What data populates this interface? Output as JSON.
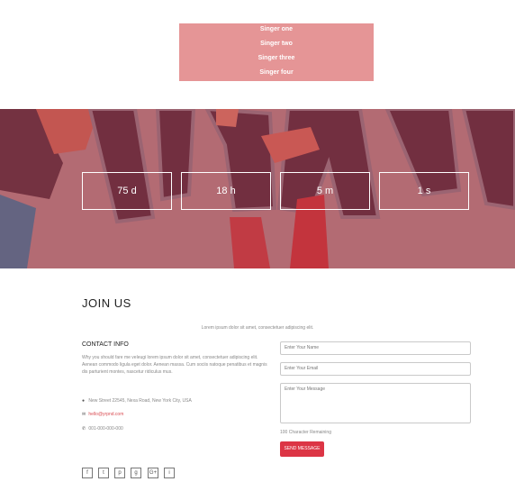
{
  "menu": {
    "items": [
      {
        "label": "Singer one"
      },
      {
        "label": "Singer two"
      },
      {
        "label": "Singer three"
      },
      {
        "label": "Singer four"
      }
    ]
  },
  "countdown": {
    "days": "75 d",
    "hours": "18 h",
    "minutes": "5 m",
    "seconds": "1 s"
  },
  "join": {
    "title": "JOIN US",
    "subtitle": "Lorem ipsum dolor sit amet, consectetuer adipiscing elit."
  },
  "contact": {
    "title": "CONTACT INFO",
    "description": "Why you should fare me veleugi lorem ipsum dolor sit amet, consectetuer adipiscing elit. Aenean commodo ligula eget dolor. Aenean massa. Cum sociis natoque penatibus et magnis dis parturient montes, nascetur ridiculus mus.",
    "address": "New Street 22545, Nexa Road, New York City, USA",
    "email": "hello@yrpnd.com",
    "phone": "001-000-000-000",
    "icons": {
      "address": "map-marker-icon",
      "email": "envelope-icon",
      "phone": "phone-icon"
    }
  },
  "form": {
    "name_placeholder": "Enter Your Name",
    "email_placeholder": "Enter Your Email",
    "message_placeholder": "Enter Your Message",
    "char_remaining": "100 Character Remaining",
    "send_label": "SEND MESSAGE"
  },
  "social": {
    "icons": [
      "facebook-icon",
      "twitter-icon",
      "pinterest-icon",
      "github-icon",
      "google-plus-icon",
      "instagram-icon"
    ],
    "glyphs": [
      "f",
      "t",
      "p",
      "g",
      "G+",
      "i"
    ]
  },
  "colors": {
    "menu_bg": "#e59596",
    "hero_bg": "#b56d73",
    "accent": "#dc3545",
    "link": "#d94c52"
  }
}
